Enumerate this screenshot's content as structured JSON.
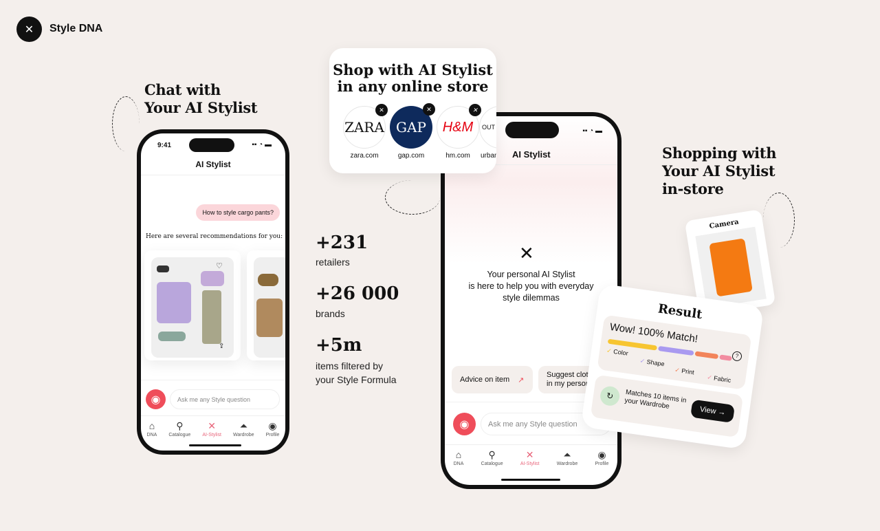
{
  "brand": {
    "name": "Style DNA",
    "logo_icon": "hanger-knot-icon"
  },
  "headlines": {
    "chat": [
      "Chat with",
      "Your AI Stylist"
    ],
    "shop": [
      "Shop with AI Stylist",
      "in any online store"
    ],
    "instore": [
      "Shopping with",
      "Your AI Stylist",
      "in-store"
    ]
  },
  "stats": [
    {
      "value": "+231",
      "label": "retailers"
    },
    {
      "value": "+26 000",
      "label": "brands"
    },
    {
      "value": "+5m",
      "label": "items filtered by",
      "label2": "your Style Formula"
    }
  ],
  "stores": [
    {
      "logo": "ZARA",
      "domain": "zara.com",
      "bg": "#ffffff",
      "fg": "#111111"
    },
    {
      "logo": "GAP",
      "domain": "gap.com",
      "bg": "#0e2a5c",
      "fg": "#ffffff"
    },
    {
      "logo": "H&M",
      "domain": "hm.com",
      "bg": "#ffffff",
      "fg": "#e50010"
    },
    {
      "logo": "OUT",
      "domain": "urban",
      "bg": "#ffffff",
      "fg": "#111111"
    }
  ],
  "phone1": {
    "time": "9:41",
    "title": "AI Stylist",
    "user_message": "How to style cargo pants?",
    "reply": "Here are several recommendations for you:",
    "input_placeholder": "Ask me any Style question"
  },
  "phone2": {
    "title": "AI Stylist",
    "welcome": [
      "Your personal AI Stylist",
      "is here to help you with everyday",
      "style dilemmas"
    ],
    "chips": [
      "Advice on item",
      "Suggest cloth",
      "in my person"
    ],
    "input_placeholder": "Ask me any Style question"
  },
  "nav": [
    {
      "label": "DNA",
      "icon": "home-icon"
    },
    {
      "label": "Catalogue",
      "icon": "search-icon"
    },
    {
      "label": "AI-Stylist",
      "icon": "stylist-icon",
      "active": true
    },
    {
      "label": "Wardrobe",
      "icon": "hanger-icon"
    },
    {
      "label": "Profile",
      "icon": "profile-icon"
    }
  ],
  "camera": {
    "title": "Camera"
  },
  "result": {
    "title": "Result",
    "match": "Wow! 100% Match!",
    "criteria": [
      {
        "label": "Color",
        "color": "#f7c531"
      },
      {
        "label": "Shape",
        "color": "#a99af0"
      },
      {
        "label": "Print",
        "color": "#f2845a"
      },
      {
        "label": "Fabric",
        "color": "#f28ca0"
      }
    ],
    "wardrobe": [
      "Matches 10 items in",
      "your Wardrobe"
    ],
    "view_label": "View →"
  },
  "colors": {
    "accent": "#ef4d5a",
    "background": "#f4efec"
  }
}
